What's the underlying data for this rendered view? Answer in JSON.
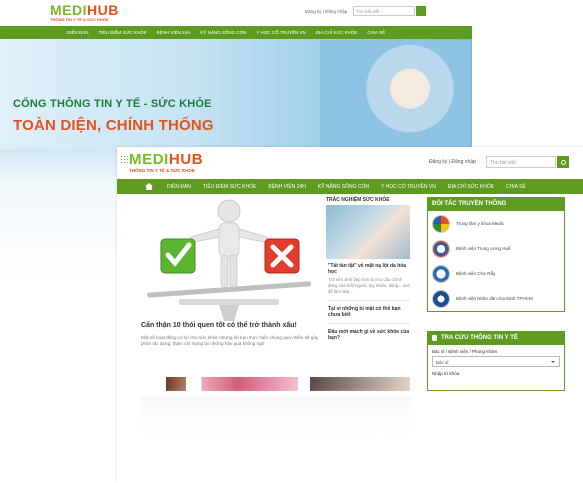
{
  "back": {
    "logo_name_a": "MEDI",
    "logo_name_b": "HUB",
    "logo_tag": "THÔNG TIN Y TẾ & SỨC KHỎE",
    "auth": "Đăng ký | Đăng nhập",
    "search_placeholder": "Tìm bài viết",
    "nav": [
      "DIỄN ĐÀN",
      "TIÊU ĐIỂM SỨC KHỎE",
      "BỆNH VIỆN 24H",
      "KỸ NĂNG SỐNG CÒN",
      "Y HỌC CỔ TRUYỀN VN",
      "ĐỊA CHỈ SỨC KHỎE",
      "CHIA SẺ"
    ],
    "banner_line1": "CỔNG THÔNG TIN Y TẾ - SỨC KHỎE",
    "banner_line2": "TOÀN DIỆN, CHÍNH THỐNG"
  },
  "front": {
    "logo_name_a": "MEDI",
    "logo_name_b": "HUB",
    "logo_tag": "THÔNG TIN Y TẾ & SỨC KHỎE",
    "auth": "Đăng ký | Đăng nhập",
    "search_placeholder": "Tìm bài viết",
    "nav": [
      "DIỄN ĐÀN",
      "TIÊU ĐIỂM SỨC KHỎE",
      "BỆNH VIỆN 24H",
      "KỸ NĂNG SỐNG CÒN",
      "Y HỌC CỔ TRUYỀN VN",
      "ĐỊA CHỈ SỨC KHỎE",
      "CHIA SẺ"
    ],
    "hero_title": "Cẩn thận 10 thói quen tốt có thể trở thành xấu!",
    "hero_desc": "Một số hoạt động có lợi cho sức khỏe nhưng lời bạn thực hiện chúng quá nhiều sẽ gây phản tác dụng, thậm chí mang lại những hậu quả không ngờ.",
    "mid_head": "TRẮC NGHIỆM SỨC KHỎE",
    "mid_items": [
      {
        "title": "\"Tất tần tật\" về mặt nạ lột da hóa học",
        "desc": "Trở nên xinh đẹp hơn là nhu cầu chính đáng của mỗi người, tuy nhiên, dùng... axit để làm đẹp..."
      },
      {
        "title": "Tại vì những bí mật có thể bạn chưa biết",
        "desc": ""
      },
      {
        "title": "Đâu mới mách gì về sức khỏe của bạn?",
        "desc": ""
      }
    ],
    "partners_head": "ĐỐI TÁC TRUYỀN THÔNG",
    "partners": [
      {
        "name": "Trung tâm y khoa Medic",
        "color": "#e94e1b"
      },
      {
        "name": "Bệnh viện Trung ương Huế",
        "color": "#2e5da8"
      },
      {
        "name": "Bệnh viện Chợ Rẫy",
        "color": "#2a6cb3"
      },
      {
        "name": "Bệnh viện Nhân dân Gia Định TPHCM",
        "color": "#1e4c8f"
      }
    ],
    "lookup_head": "TRA CỨU THÔNG TIN Y TẾ",
    "lookup_label1": "Bác sĩ / Bệnh viện / Phòng khám",
    "lookup_select": "Bác sĩ",
    "lookup_label2": "Nhập từ khóa"
  },
  "colors": {
    "green": "#5d9c1e",
    "logo_green": "#7ab829",
    "orange": "#e94e1b"
  }
}
